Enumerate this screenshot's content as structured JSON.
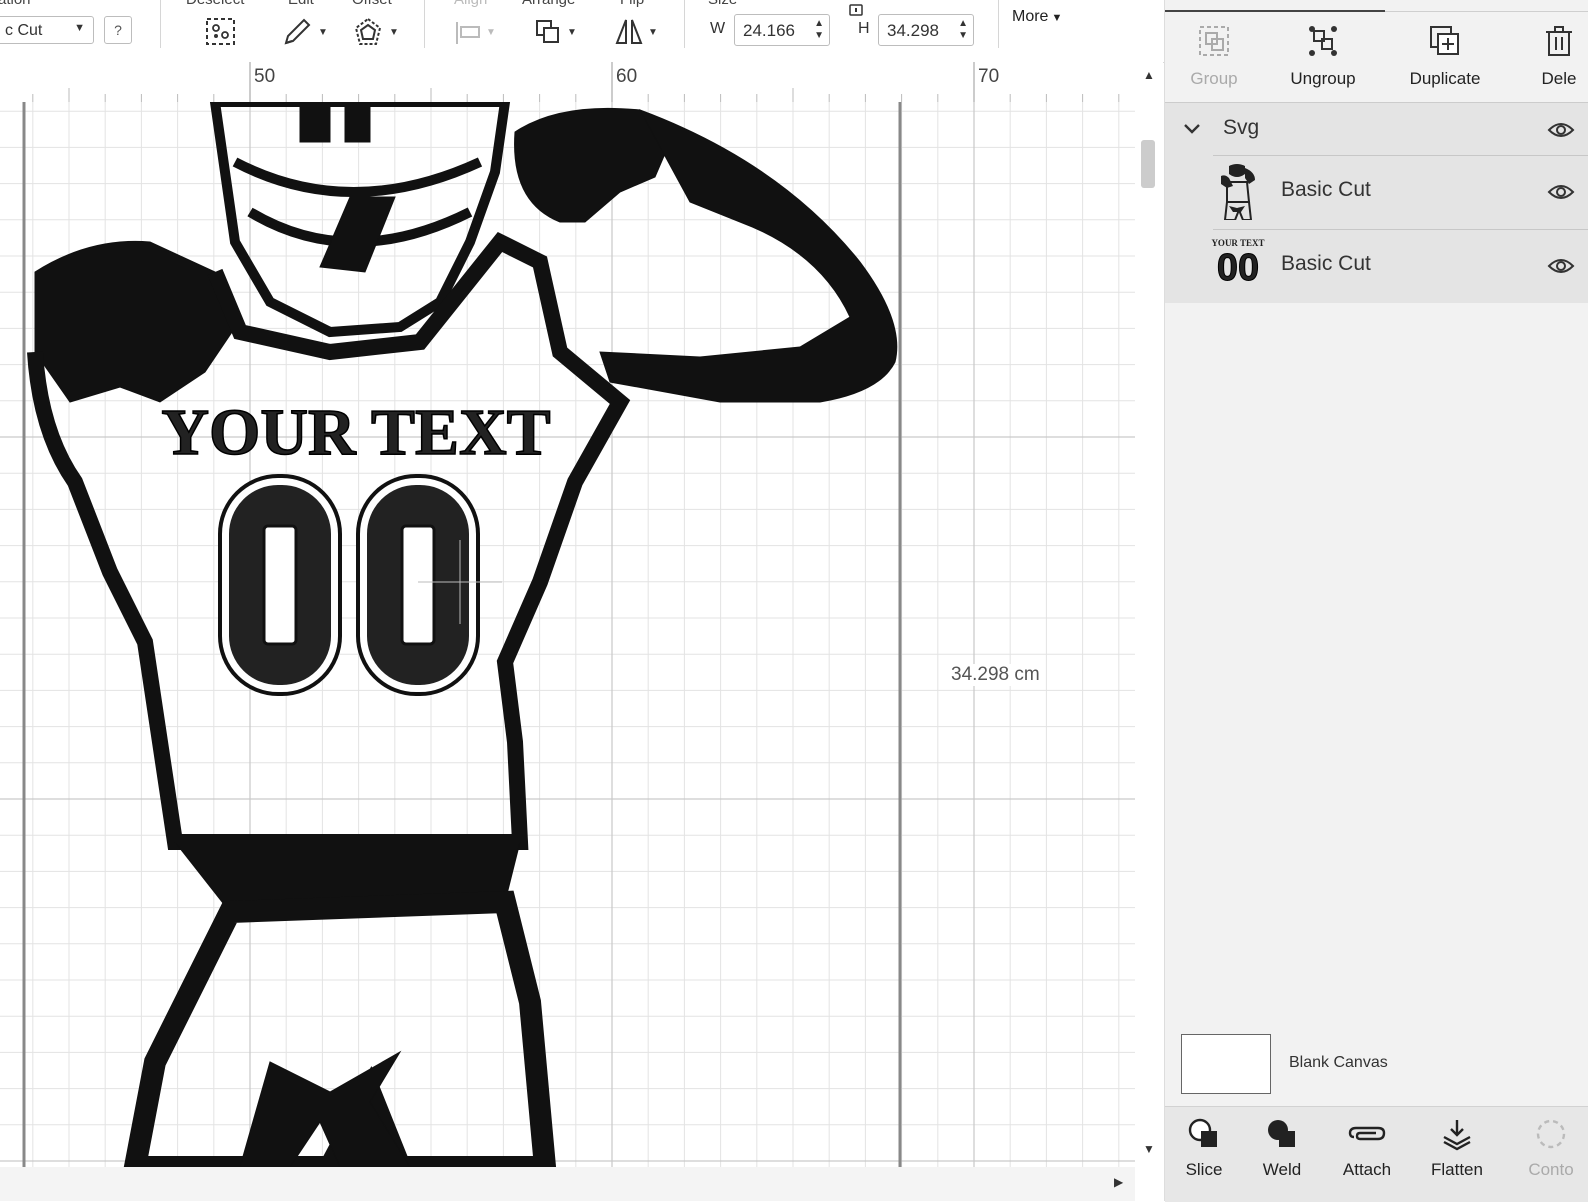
{
  "toolbar": {
    "operation_caption": "ation",
    "operation_value": "c Cut",
    "help_label": "?",
    "deselect_caption": "Deselect",
    "edit_caption": "Edit",
    "offset_caption": "Offset",
    "align_caption": "Align",
    "arrange_caption": "Arrange",
    "flip_caption": "Flip",
    "size_caption": "Size",
    "width_label": "W",
    "width_value": "24.166",
    "height_label": "H",
    "height_value": "34.298",
    "more_label": "More"
  },
  "ruler": {
    "marks": [
      "50",
      "60",
      "70"
    ]
  },
  "canvas": {
    "height_dimension": "34.298 cm",
    "artwork": {
      "jersey_text": "YOUR TEXT",
      "jersey_number": "00"
    }
  },
  "panel": {
    "buttons": [
      {
        "label": "Group",
        "icon": "group-icon",
        "enabled": false
      },
      {
        "label": "Ungroup",
        "icon": "ungroup-icon",
        "enabled": true
      },
      {
        "label": "Duplicate",
        "icon": "duplicate-icon",
        "enabled": true
      },
      {
        "label": "Dele",
        "icon": "delete-icon",
        "enabled": true
      }
    ],
    "layers": {
      "group_name": "Svg",
      "items": [
        {
          "name": "Basic Cut",
          "thumb": "player-thumbnail"
        },
        {
          "name": "Basic Cut",
          "thumb": "text-number-thumbnail",
          "thumb_text": "YOUR TEXT",
          "thumb_number": "00"
        }
      ]
    },
    "blank_canvas_label": "Blank Canvas",
    "bottom_buttons": [
      {
        "label": "Slice",
        "icon": "slice-icon",
        "enabled": true
      },
      {
        "label": "Weld",
        "icon": "weld-icon",
        "enabled": true
      },
      {
        "label": "Attach",
        "icon": "attach-icon",
        "enabled": true
      },
      {
        "label": "Flatten",
        "icon": "flatten-icon",
        "enabled": true
      },
      {
        "label": "Conto",
        "icon": "contour-icon",
        "enabled": false
      }
    ]
  }
}
